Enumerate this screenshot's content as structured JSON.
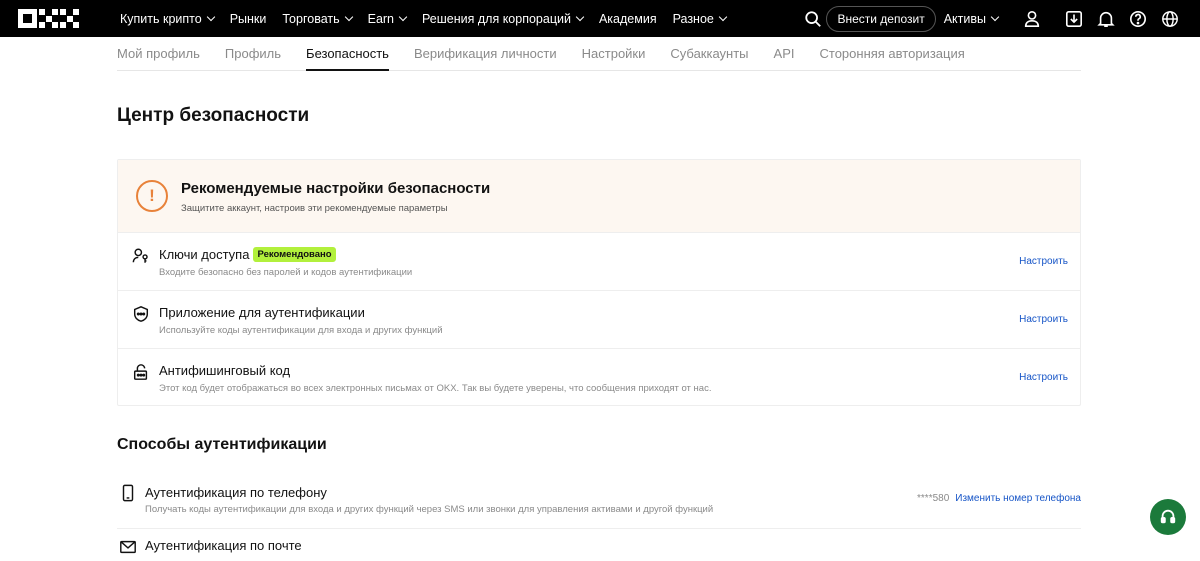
{
  "topbar": {
    "nav": [
      {
        "label": "Купить крипто",
        "dropdown": true
      },
      {
        "label": "Рынки",
        "dropdown": false
      },
      {
        "label": "Торговать",
        "dropdown": true
      },
      {
        "label": "Earn",
        "dropdown": true
      },
      {
        "label": "Решения для корпораций",
        "dropdown": true
      },
      {
        "label": "Академия",
        "dropdown": false
      },
      {
        "label": "Разное",
        "dropdown": true
      }
    ],
    "deposit_label": "Внести депозит",
    "assets_label": "Активы"
  },
  "tabs": [
    {
      "label": "Мой профиль",
      "active": false
    },
    {
      "label": "Профиль",
      "active": false
    },
    {
      "label": "Безопасность",
      "active": true
    },
    {
      "label": "Верификация личности",
      "active": false
    },
    {
      "label": "Настройки",
      "active": false
    },
    {
      "label": "Субаккаунты",
      "active": false
    },
    {
      "label": "API",
      "active": false
    },
    {
      "label": "Сторонняя авторизация",
      "active": false
    }
  ],
  "page_title": "Центр безопасности",
  "recommended": {
    "title": "Рекомендуемые настройки безопасности",
    "subtitle": "Защитите аккаунт, настроив эти рекомендуемые параметры",
    "rows": [
      {
        "title": "Ключи доступа",
        "badge": "Рекомендовано",
        "subtitle": "Входите безопасно без паролей и кодов аутентификации",
        "action": "Настроить",
        "icon": "passkey-icon"
      },
      {
        "title": "Приложение для аутентификации",
        "badge": "",
        "subtitle": "Используйте коды аутентификации для входа и других функций",
        "action": "Настроить",
        "icon": "shield-icon"
      },
      {
        "title": "Антифишинговый код",
        "badge": "",
        "subtitle": "Этот код будет отображаться во всех электронных письмах от OKX. Так вы будете уверены, что сообщения приходят от нас.",
        "action": "Настроить",
        "icon": "lock-icon"
      }
    ]
  },
  "auth_methods": {
    "title": "Способы аутентификации",
    "phone": {
      "title": "Аутентификация по телефону",
      "subtitle": "Получать коды аутентификации для входа и других функций через SMS или звонки для управления активами и другой функций",
      "masked": "****580",
      "action": "Изменить номер телефона"
    },
    "next_title": "Аутентификация по почте"
  },
  "colors": {
    "accent": "#1554c7",
    "warning": "#e8823a",
    "badge": "#b2f03c",
    "support": "#1b7a3b"
  }
}
